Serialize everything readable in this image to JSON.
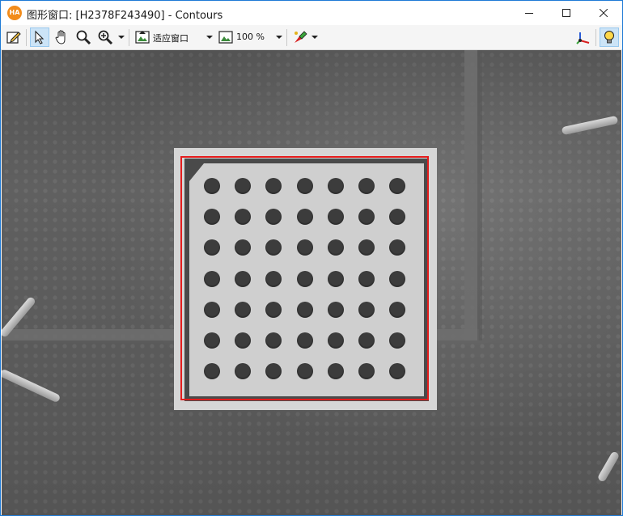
{
  "window": {
    "app_icon_text": "HA",
    "title": "图形窗口: [H2378F243490] - Contours",
    "controls": {
      "minimize": "minimize",
      "maximize": "maximize",
      "close": "close"
    }
  },
  "toolbar": {
    "tools": [
      "edit-icon",
      "pointer-icon",
      "hand-icon",
      "magnifier-icon",
      "zoom-in-icon"
    ],
    "fit_mode": "适应窗口",
    "zoom": "100 %",
    "right_tools": [
      "paint-icon",
      "axes-icon",
      "lightbulb-icon"
    ]
  },
  "image": {
    "grid_rows": 7,
    "grid_cols": 7,
    "contour_color": "#e41b1b",
    "background_color": "#606060"
  }
}
